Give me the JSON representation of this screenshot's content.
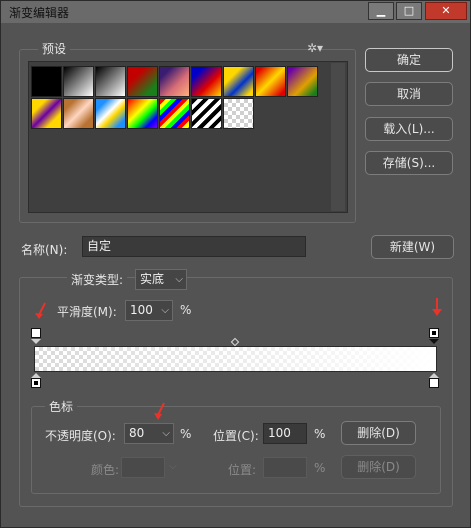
{
  "window": {
    "title": "渐变编辑器",
    "minimize_glyph": "▁",
    "maximize_glyph": "□",
    "close_glyph": "✕"
  },
  "presets": {
    "legend": "预设",
    "gear_glyph": "✲▾",
    "swatches_row1": [
      "linear-gradient(135deg,#000,#000)",
      "linear-gradient(135deg,#000 0%,#fff 100%)",
      "linear-gradient(135deg,#000 0%,#fff 100%)",
      "linear-gradient(135deg,#c20000 30%,#1a7f1a 80%)",
      "linear-gradient(135deg,#3a1c71 20%,#d76d77 60%,#ffaf7b 100%)",
      "linear-gradient(135deg,#0000c8 20%,#e00000 60%,#ffd800 100%)",
      "linear-gradient(135deg,#ffd700 30%,#0033cc 60%,#ffd700 90%)",
      "linear-gradient(135deg,#e00000 10%,#ffd800 50%,#e00000 90%)",
      "linear-gradient(135deg,#6a00a8 10%,#e0a000 60%,#1a7f1a 90%)"
    ],
    "swatches_row2": [
      "linear-gradient(135deg,#ffd700 25%,#6a00a8 50%,#ffd700 75%)",
      "linear-gradient(135deg,#b87333 20%,#ffd6c0 50%,#b87333 80%)",
      "linear-gradient(135deg,#1e90ff 20%,#ffffff 45%,#ffd700 60%,#1e90ff 85%)",
      "linear-gradient(135deg,#ff0000,#ff8000,#ffff00,#00ff00,#0000ff,#8000ff)",
      "repeating-linear-gradient(135deg,#ff0000 0 4px,#ffff00 4px 8px,#00ff00 8px 12px,#0000ff 12px 16px)",
      "repeating-linear-gradient(135deg,#000 0 4px,#fff 4px 8px)",
      "checker"
    ]
  },
  "buttons": {
    "ok": "确定",
    "cancel": "取消",
    "load": "载入(L)...",
    "save": "存储(S)...",
    "new": "新建(W)",
    "delete": "删除(D)",
    "delete_disabled": "删除(D)"
  },
  "name_field": {
    "label": "名称(N):",
    "value": "自定"
  },
  "gradient": {
    "type_label": "渐变类型:",
    "type_value": "实底",
    "smooth_label": "平滑度(M):",
    "smooth_value": "100",
    "smooth_unit": "%"
  },
  "color_stops": {
    "legend": "色标",
    "opacity_label": "不透明度(O):",
    "opacity_value": "80",
    "opacity_unit": "%",
    "position_label": "位置(C):",
    "position_value": "100",
    "position_unit": "%",
    "color_label": "颜色:",
    "color_position_label": "位置:",
    "color_position_unit": "%"
  },
  "colors": {
    "arrow": "#e8332a",
    "accent_border": "#c8c8c8"
  }
}
